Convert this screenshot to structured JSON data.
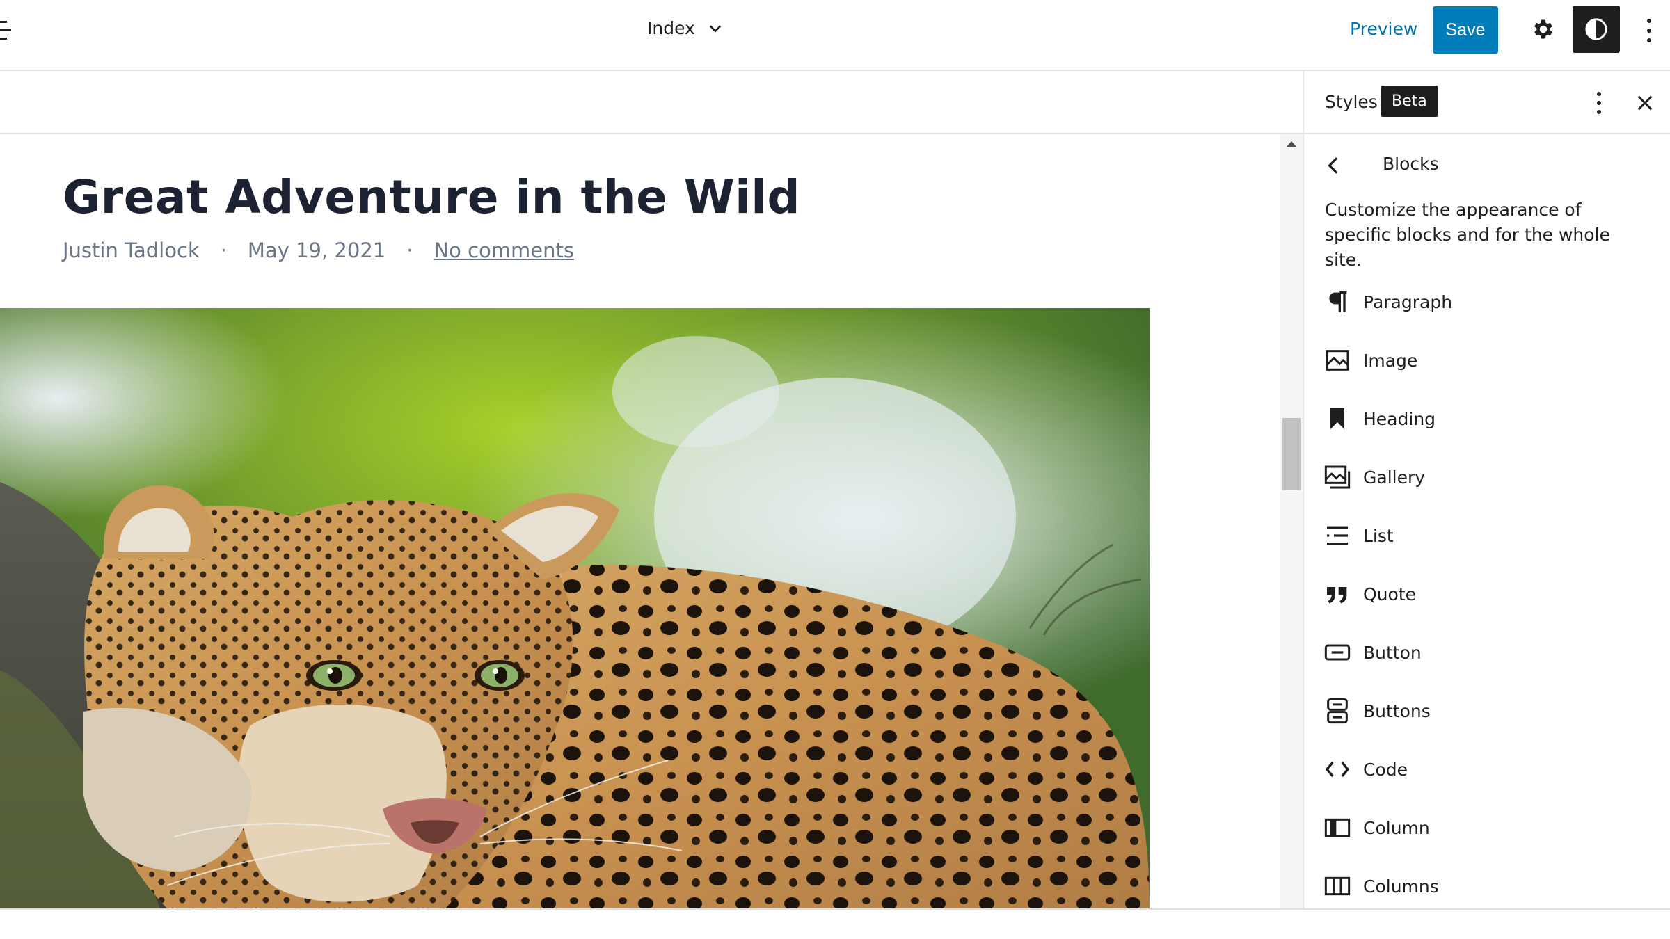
{
  "topbar": {
    "document_title": "Index",
    "preview_label": "Preview",
    "save_label": "Save"
  },
  "post": {
    "title": "Great Adventure in the Wild",
    "author": "Justin Tadlock",
    "separator": "·",
    "date": "May 19, 2021",
    "comments_link": "No comments"
  },
  "sidebar": {
    "title": "Styles",
    "badge": "Beta",
    "nav_title": "Blocks",
    "description": "Customize the appearance of specific blocks and for the whole site.",
    "blocks": [
      {
        "label": "Paragraph",
        "icon": "paragraph-icon"
      },
      {
        "label": "Image",
        "icon": "image-icon"
      },
      {
        "label": "Heading",
        "icon": "heading-icon"
      },
      {
        "label": "Gallery",
        "icon": "gallery-icon"
      },
      {
        "label": "List",
        "icon": "list-icon"
      },
      {
        "label": "Quote",
        "icon": "quote-icon"
      },
      {
        "label": "Button",
        "icon": "button-icon"
      },
      {
        "label": "Buttons",
        "icon": "buttons-icon"
      },
      {
        "label": "Code",
        "icon": "code-icon"
      },
      {
        "label": "Column",
        "icon": "column-icon"
      },
      {
        "label": "Columns",
        "icon": "columns-icon"
      }
    ]
  },
  "colors": {
    "accent": "#007cba",
    "link": "#0073aa",
    "title": "#1c2232",
    "meta": "#6b7686"
  }
}
